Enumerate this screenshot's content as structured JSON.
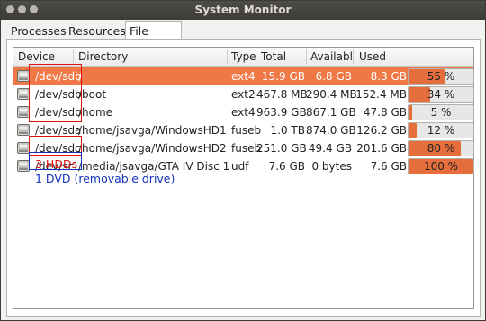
{
  "window": {
    "title": "System Monitor"
  },
  "tabs": [
    {
      "label": "Processes",
      "active": false
    },
    {
      "label": "Resources",
      "active": false
    },
    {
      "label": "File Systems",
      "active": true
    }
  ],
  "columns": {
    "device": "Device",
    "directory": "Directory",
    "type": "Type",
    "total": "Total",
    "available": "Availabl",
    "used": "Used"
  },
  "rows": [
    {
      "device": "/dev/sdb",
      "directory": "/",
      "type": "ext4",
      "total": "15.9 GB",
      "available": "6.8 GB",
      "used": "8.3 GB",
      "percent": 55,
      "percent_label": "55 %",
      "selected": true
    },
    {
      "device": "/dev/sdb",
      "directory": "/boot",
      "type": "ext2",
      "total": "467.8 MB",
      "available": "290.4 MB",
      "used": "152.4 MB",
      "percent": 34,
      "percent_label": "34 %",
      "selected": false
    },
    {
      "device": "/dev/sdb",
      "directory": "/home",
      "type": "ext4",
      "total": "963.9 GB",
      "available": "867.1 GB",
      "used": "47.8 GB",
      "percent": 5,
      "percent_label": "5 %",
      "selected": false
    },
    {
      "device": "/dev/sda",
      "directory": "/home/jsavga/WindowsHD1",
      "type": "fuseb",
      "total": "1.0 TB",
      "available": "874.0 GB",
      "used": "126.2 GB",
      "percent": 12,
      "percent_label": "12 %",
      "selected": false
    },
    {
      "device": "/dev/sdc",
      "directory": "/home/jsavga/WindowsHD2",
      "type": "fuseb",
      "total": "251.0 GB",
      "available": "49.4 GB",
      "used": "201.6 GB",
      "percent": 80,
      "percent_label": "80 %",
      "selected": false
    },
    {
      "device": "/dev/sr1",
      "directory": "/media/jsavga/GTA IV Disc 1",
      "type": "udf",
      "total": "7.6 GB",
      "available": "0 bytes",
      "used": "7.6 GB",
      "percent": 100,
      "percent_label": "100 %",
      "selected": false
    }
  ],
  "annotations": {
    "hdd_label": "3 HDDs",
    "dvd_label": "1 DVD (removable drive)",
    "hdd_color": "#dd1111",
    "dvd_color": "#1133bb"
  },
  "colors": {
    "selection": "#f07746",
    "bar_fill": "#e66e3c"
  }
}
